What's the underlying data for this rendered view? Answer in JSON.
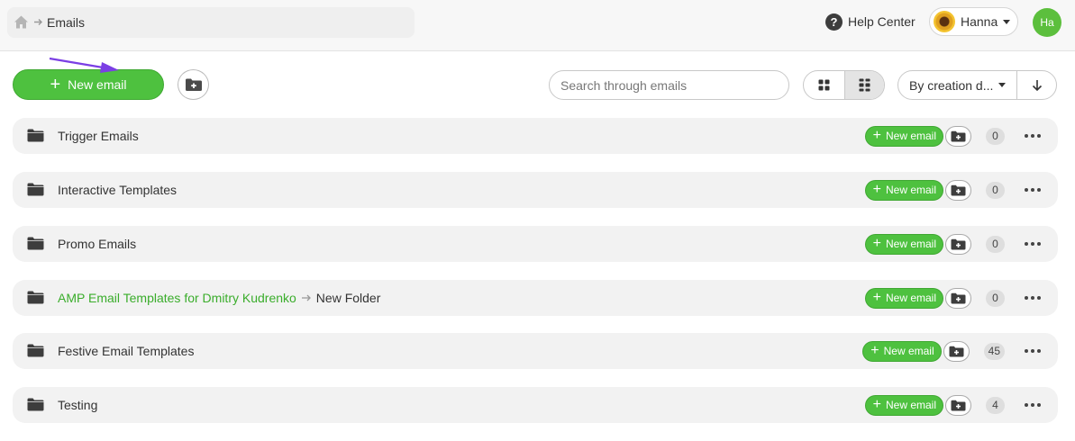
{
  "header": {
    "breadcrumb_current": "Emails",
    "help_label": "Help Center",
    "help_icon": "question-icon",
    "user_name": "Hanna",
    "avatar_initials": "Ha"
  },
  "toolbar": {
    "new_email_label": "New email",
    "search_placeholder": "Search through emails",
    "sort_label": "By creation d...",
    "view_modes": [
      "grid-icon",
      "list-grid-icon"
    ],
    "active_view": "list-grid-icon"
  },
  "colors": {
    "accent": "#4ec13f",
    "link": "#3aad2b",
    "annotation": "#7b3fe4"
  },
  "folders": [
    {
      "title": "Trigger Emails",
      "new_label": "New email",
      "count": "0"
    },
    {
      "title": "Interactive Templates",
      "new_label": "New email",
      "count": "0"
    },
    {
      "title": "Promo Emails",
      "new_label": "New email",
      "count": "0"
    },
    {
      "title_parent": "AMP Email Templates for Dmitry Kudrenko",
      "title": "New Folder",
      "new_label": "New email",
      "count": "0"
    },
    {
      "title": "Festive Email Templates",
      "new_label": "New email",
      "count": "45"
    },
    {
      "title": "Testing",
      "new_label": "New email",
      "count": "4"
    }
  ]
}
